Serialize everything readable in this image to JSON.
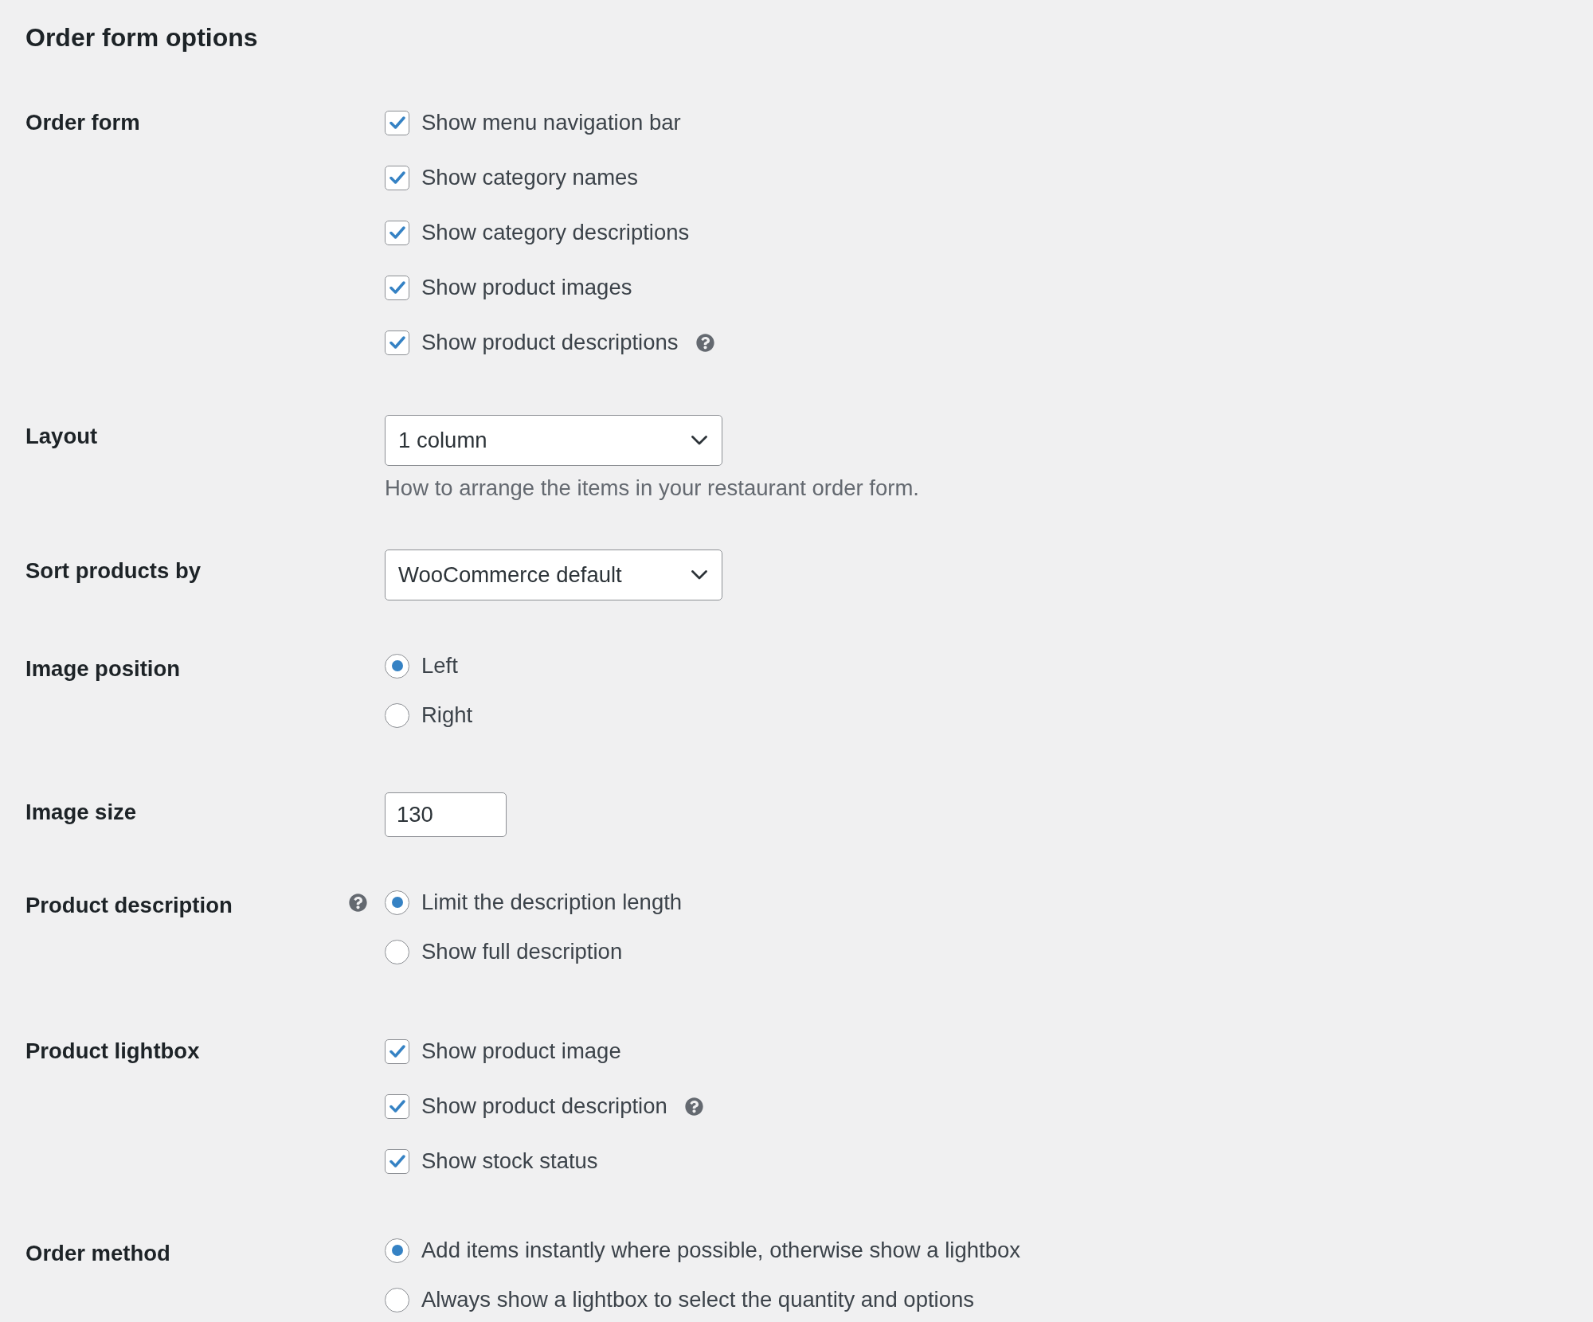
{
  "title": "Order form options",
  "settings": [
    {
      "kind": "checkboxes",
      "label": "Order form",
      "help": false,
      "options": [
        {
          "label": "Show menu navigation bar",
          "checked": true,
          "help": false
        },
        {
          "label": "Show category names",
          "checked": true,
          "help": false
        },
        {
          "label": "Show category descriptions",
          "checked": true,
          "help": false
        },
        {
          "label": "Show product images",
          "checked": true,
          "help": false
        },
        {
          "label": "Show product descriptions",
          "checked": true,
          "help": true
        }
      ]
    },
    {
      "kind": "select",
      "label": "Layout",
      "help": false,
      "value": "1 column",
      "description": "How to arrange the items in your restaurant order form."
    },
    {
      "kind": "select",
      "label": "Sort products by",
      "help": false,
      "value": "WooCommerce default"
    },
    {
      "kind": "radios",
      "label": "Image position",
      "help": false,
      "options": [
        {
          "label": "Left",
          "selected": true
        },
        {
          "label": "Right",
          "selected": false
        }
      ]
    },
    {
      "kind": "number",
      "label": "Image size",
      "help": false,
      "value": "130"
    },
    {
      "kind": "radios",
      "label": "Product description",
      "help": true,
      "options": [
        {
          "label": "Limit the description length",
          "selected": true
        },
        {
          "label": "Show full description",
          "selected": false
        }
      ]
    },
    {
      "kind": "checkboxes",
      "label": "Product lightbox",
      "help": false,
      "options": [
        {
          "label": "Show product image",
          "checked": true,
          "help": false
        },
        {
          "label": "Show product description",
          "checked": true,
          "help": true
        },
        {
          "label": "Show stock status",
          "checked": true,
          "help": false
        }
      ]
    },
    {
      "kind": "radios",
      "label": "Order method",
      "help": false,
      "options": [
        {
          "label": "Add items instantly where possible, otherwise show a lightbox",
          "selected": true
        },
        {
          "label": "Always show a lightbox to select the quantity and options",
          "selected": false
        }
      ]
    }
  ]
}
